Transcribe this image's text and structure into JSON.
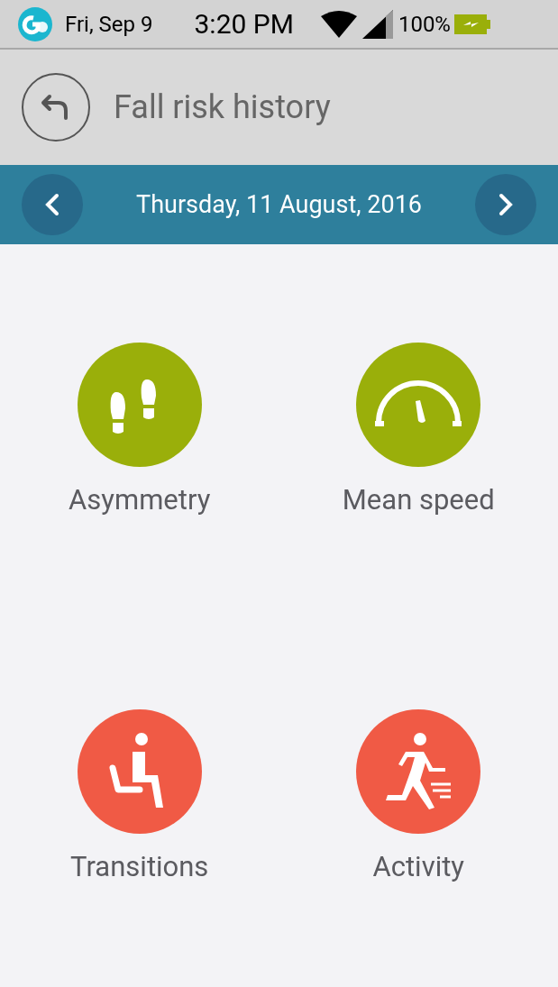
{
  "status_bar": {
    "date": "Fri, Sep 9",
    "time": "3:20 PM",
    "battery": "100%"
  },
  "header": {
    "title": "Fall risk history"
  },
  "date_bar": {
    "date": "Thursday, 11 August, 2016"
  },
  "tiles": [
    {
      "label": "Asymmetry",
      "kind": "footprints",
      "color": "#9aaf0a"
    },
    {
      "label": "Mean speed",
      "kind": "gauge",
      "color": "#9aaf0a"
    },
    {
      "label": "Transitions",
      "kind": "seated",
      "color": "#f05a45"
    },
    {
      "label": "Activity",
      "kind": "running",
      "color": "#f05a45"
    }
  ]
}
